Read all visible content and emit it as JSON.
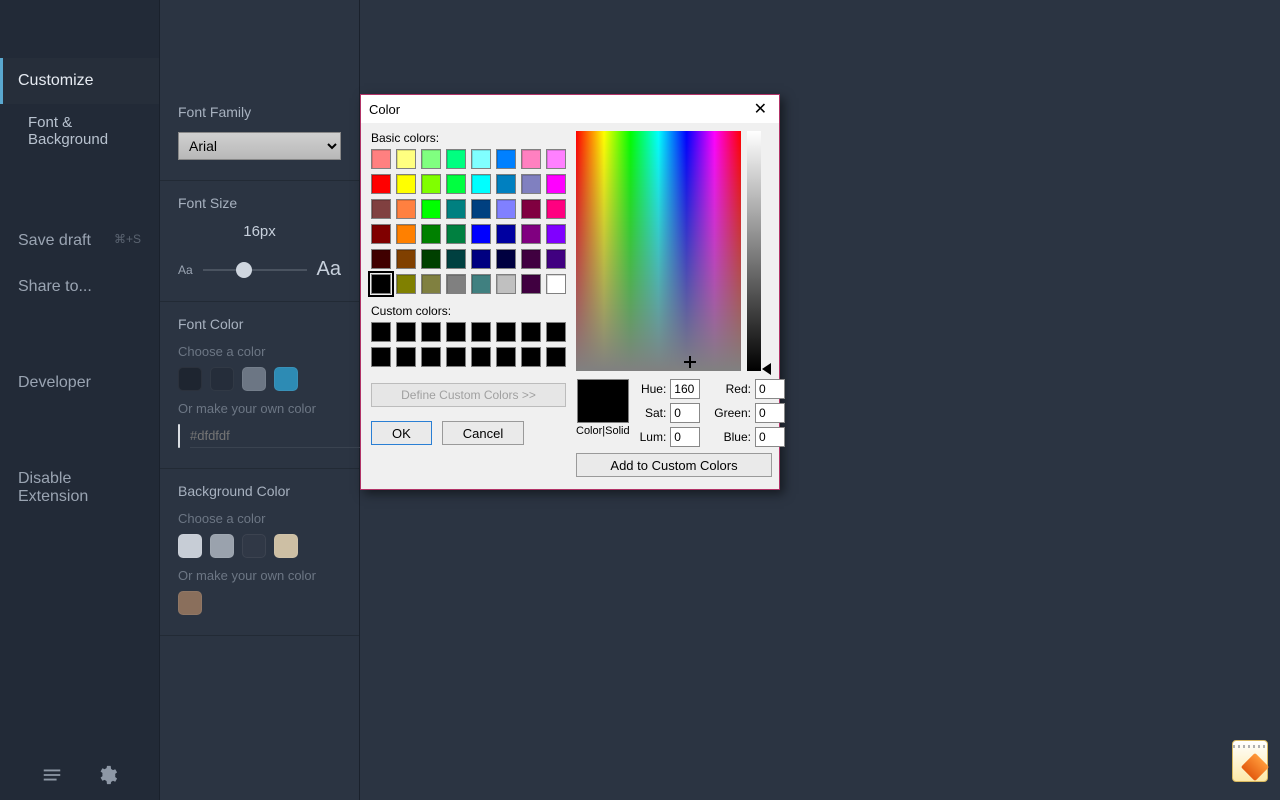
{
  "nav": {
    "customize": "Customize",
    "font_bg": "Font & Background",
    "save_draft": "Save draft",
    "save_kbd": "⌘+S",
    "share_to": "Share to...",
    "developer": "Developer",
    "disable_ext": "Disable Extension"
  },
  "panel": {
    "font_family_label": "Font Family",
    "font_family_value": "Arial",
    "font_size_label": "Font Size",
    "font_size_value": "16px",
    "slider_small": "Aa",
    "slider_large": "Aa",
    "font_color_label": "Font Color",
    "choose_color": "Choose a color",
    "own_color": "Or make your own color",
    "hex_placeholder": "#dfdfdf",
    "bg_color_label": "Background Color",
    "font_swatches": [
      "#1e2530",
      "#252d3a",
      "#6c7684",
      "#2d8bb4"
    ],
    "bg_swatches": [
      "#c7cdd6",
      "#9aa2ad",
      "#303846",
      "#cdbfa4"
    ],
    "own_color2": "Or make your own color"
  },
  "dialog": {
    "title": "Color",
    "basic_label": "Basic colors:",
    "custom_label": "Custom colors:",
    "define_btn": "Define Custom Colors >>",
    "ok": "OK",
    "cancel": "Cancel",
    "color_solid": "Color|Solid",
    "hue_label": "Hue:",
    "sat_label": "Sat:",
    "lum_label": "Lum:",
    "red_label": "Red:",
    "green_label": "Green:",
    "blue_label": "Blue:",
    "hue": "160",
    "sat": "0",
    "lum": "0",
    "red": "0",
    "green": "0",
    "blue": "0",
    "add_custom": "Add to Custom Colors",
    "basic_colors": [
      "#ff8080",
      "#ffff80",
      "#80ff80",
      "#00ff80",
      "#80ffff",
      "#0080ff",
      "#ff80c0",
      "#ff80ff",
      "#ff0000",
      "#ffff00",
      "#80ff00",
      "#00ff40",
      "#00ffff",
      "#0080c0",
      "#8080c0",
      "#ff00ff",
      "#804040",
      "#ff8040",
      "#00ff00",
      "#008080",
      "#004080",
      "#8080ff",
      "#800040",
      "#ff0080",
      "#800000",
      "#ff8000",
      "#008000",
      "#008040",
      "#0000ff",
      "#0000a0",
      "#800080",
      "#8000ff",
      "#400000",
      "#804000",
      "#004000",
      "#004040",
      "#000080",
      "#000040",
      "#400040",
      "#400080",
      "#000000",
      "#808000",
      "#808040",
      "#808080",
      "#408080",
      "#c0c0c0",
      "#400040",
      "#ffffff"
    ],
    "custom_colors": [
      "#000000",
      "#000000",
      "#000000",
      "#000000",
      "#000000",
      "#000000",
      "#000000",
      "#000000",
      "#000000",
      "#000000",
      "#000000",
      "#000000",
      "#000000",
      "#000000",
      "#000000",
      "#000000"
    ],
    "selected_basic_index": 40
  }
}
